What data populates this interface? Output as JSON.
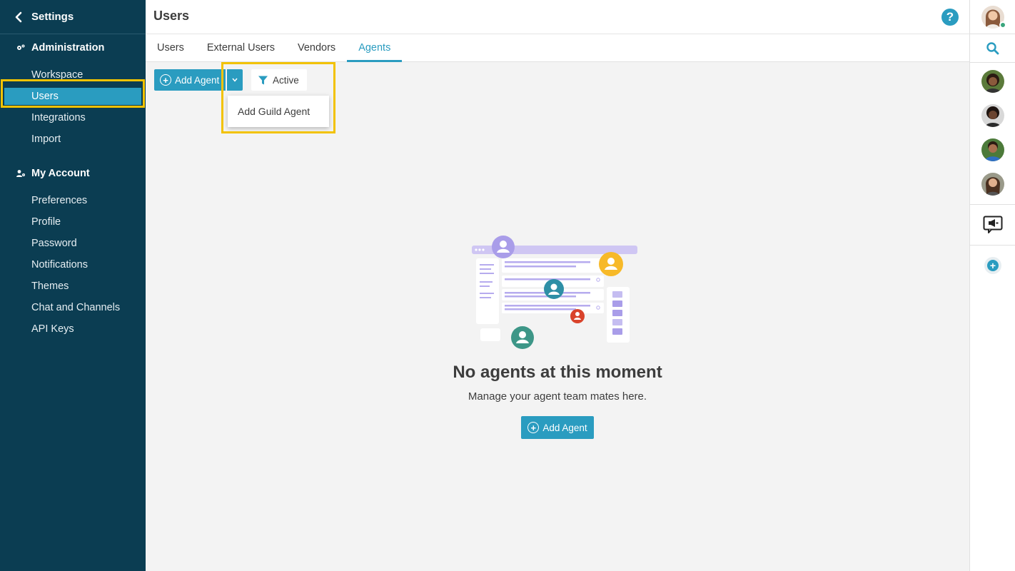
{
  "sidebar": {
    "title": "Settings",
    "sections": [
      {
        "label": "Administration",
        "items": [
          "Workspace",
          "Users",
          "Integrations",
          "Import"
        ]
      },
      {
        "label": "My Account",
        "items": [
          "Preferences",
          "Profile",
          "Password",
          "Notifications",
          "Themes",
          "Chat and Channels",
          "API Keys"
        ]
      }
    ],
    "active_item": "Users"
  },
  "header": {
    "title": "Users"
  },
  "tabs": [
    {
      "label": "Users"
    },
    {
      "label": "External Users"
    },
    {
      "label": "Vendors"
    },
    {
      "label": "Agents",
      "active": true
    }
  ],
  "toolbar": {
    "add_agent_label": "Add Agent",
    "filter_label": "Active",
    "dropdown_item": "Add Guild Agent"
  },
  "empty_state": {
    "title": "No agents at this moment",
    "subtitle": "Manage your agent team mates here.",
    "button_label": "Add Agent"
  },
  "colors": {
    "sidebar_bg": "#0b3d52",
    "accent": "#2a9cc0",
    "highlight": "#f2c200",
    "content_bg": "#f3f3f3"
  },
  "icons": [
    "back-chevron-icon",
    "administration-icon",
    "account-icon",
    "help-icon",
    "filter-icon",
    "chevron-down-icon",
    "search-icon",
    "announcement-icon",
    "plus-icon"
  ]
}
